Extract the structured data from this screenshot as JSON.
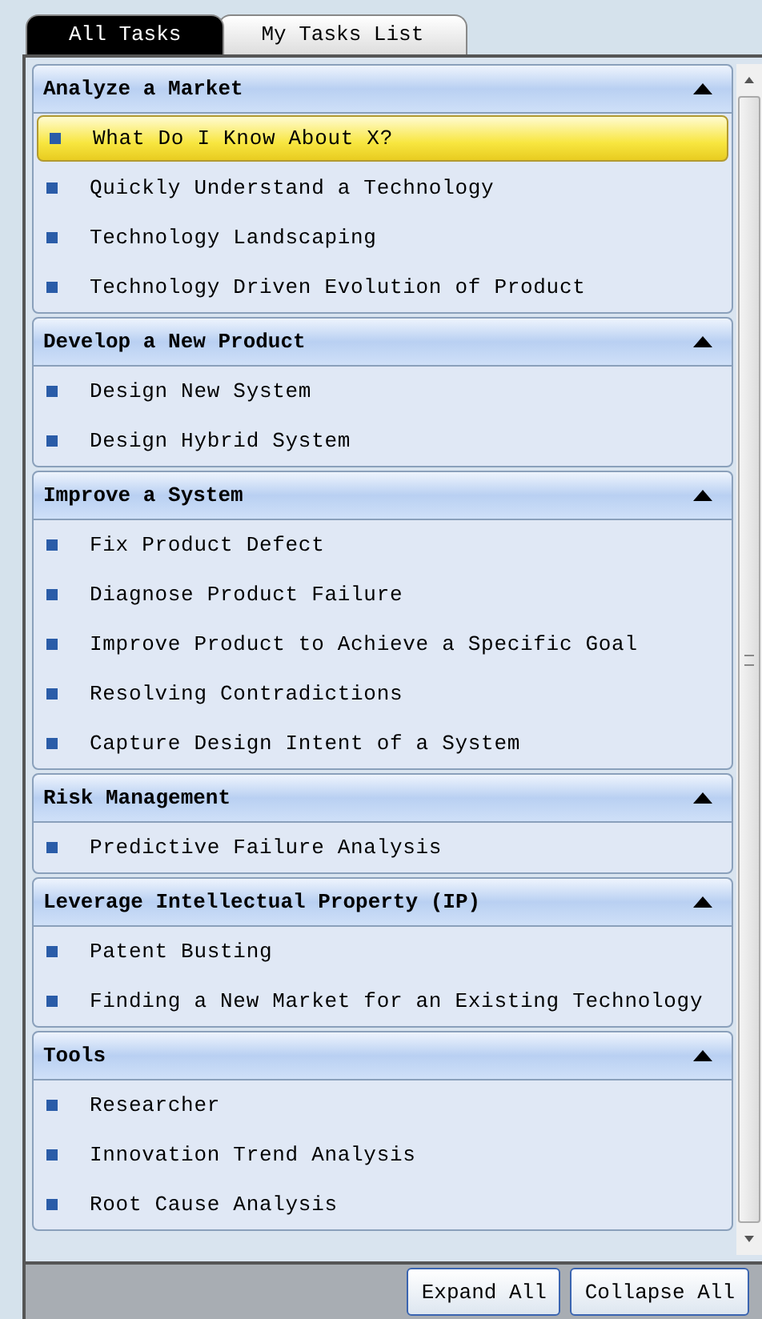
{
  "tabs": [
    {
      "label": "All Tasks",
      "selected": true
    },
    {
      "label": "My Tasks List",
      "selected": false
    }
  ],
  "groups": [
    {
      "title": "Analyze a Market",
      "expanded": true,
      "items": [
        {
          "label": "What Do I Know About X?",
          "selected": true
        },
        {
          "label": "Quickly Understand a Technology",
          "selected": false
        },
        {
          "label": "Technology Landscaping",
          "selected": false
        },
        {
          "label": "Technology Driven Evolution of Product",
          "selected": false
        }
      ]
    },
    {
      "title": "Develop a New Product",
      "expanded": true,
      "items": [
        {
          "label": "Design New System",
          "selected": false
        },
        {
          "label": "Design Hybrid System",
          "selected": false
        }
      ]
    },
    {
      "title": "Improve a System",
      "expanded": true,
      "items": [
        {
          "label": "Fix Product Defect",
          "selected": false
        },
        {
          "label": "Diagnose Product Failure",
          "selected": false
        },
        {
          "label": "Improve Product to Achieve a Specific Goal",
          "selected": false
        },
        {
          "label": "Resolving Contradictions",
          "selected": false
        },
        {
          "label": "Capture Design Intent of a System",
          "selected": false
        }
      ]
    },
    {
      "title": "Risk Management",
      "expanded": true,
      "items": [
        {
          "label": "Predictive Failure Analysis",
          "selected": false
        }
      ]
    },
    {
      "title": "Leverage Intellectual Property (IP)",
      "expanded": true,
      "items": [
        {
          "label": "Patent Busting",
          "selected": false
        },
        {
          "label": "Finding a New Market for an Existing Technology",
          "selected": false
        }
      ]
    },
    {
      "title": "Tools",
      "expanded": true,
      "items": [
        {
          "label": "Researcher",
          "selected": false
        },
        {
          "label": "Innovation Trend Analysis",
          "selected": false
        },
        {
          "label": "Root Cause Analysis",
          "selected": false
        }
      ]
    }
  ],
  "buttons": [
    "Expand All",
    "Collapse All"
  ]
}
